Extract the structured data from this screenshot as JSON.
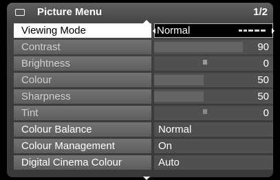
{
  "header": {
    "title": "Picture Menu",
    "page": "1/2"
  },
  "rows": [
    {
      "label": "Viewing Mode",
      "value": "Normal"
    },
    {
      "label": "Contrast",
      "value": "90",
      "level": 0.9
    },
    {
      "label": "Brightness",
      "value": "0"
    },
    {
      "label": "Colour",
      "value": "50",
      "level": 0.5
    },
    {
      "label": "Sharpness",
      "value": "50",
      "level": 0.5
    },
    {
      "label": "Tint",
      "value": "0"
    },
    {
      "label": "Colour Balance",
      "value": "Normal"
    },
    {
      "label": "Colour Management",
      "value": "On"
    },
    {
      "label": "Digital Cinema Colour",
      "value": "Auto"
    }
  ]
}
